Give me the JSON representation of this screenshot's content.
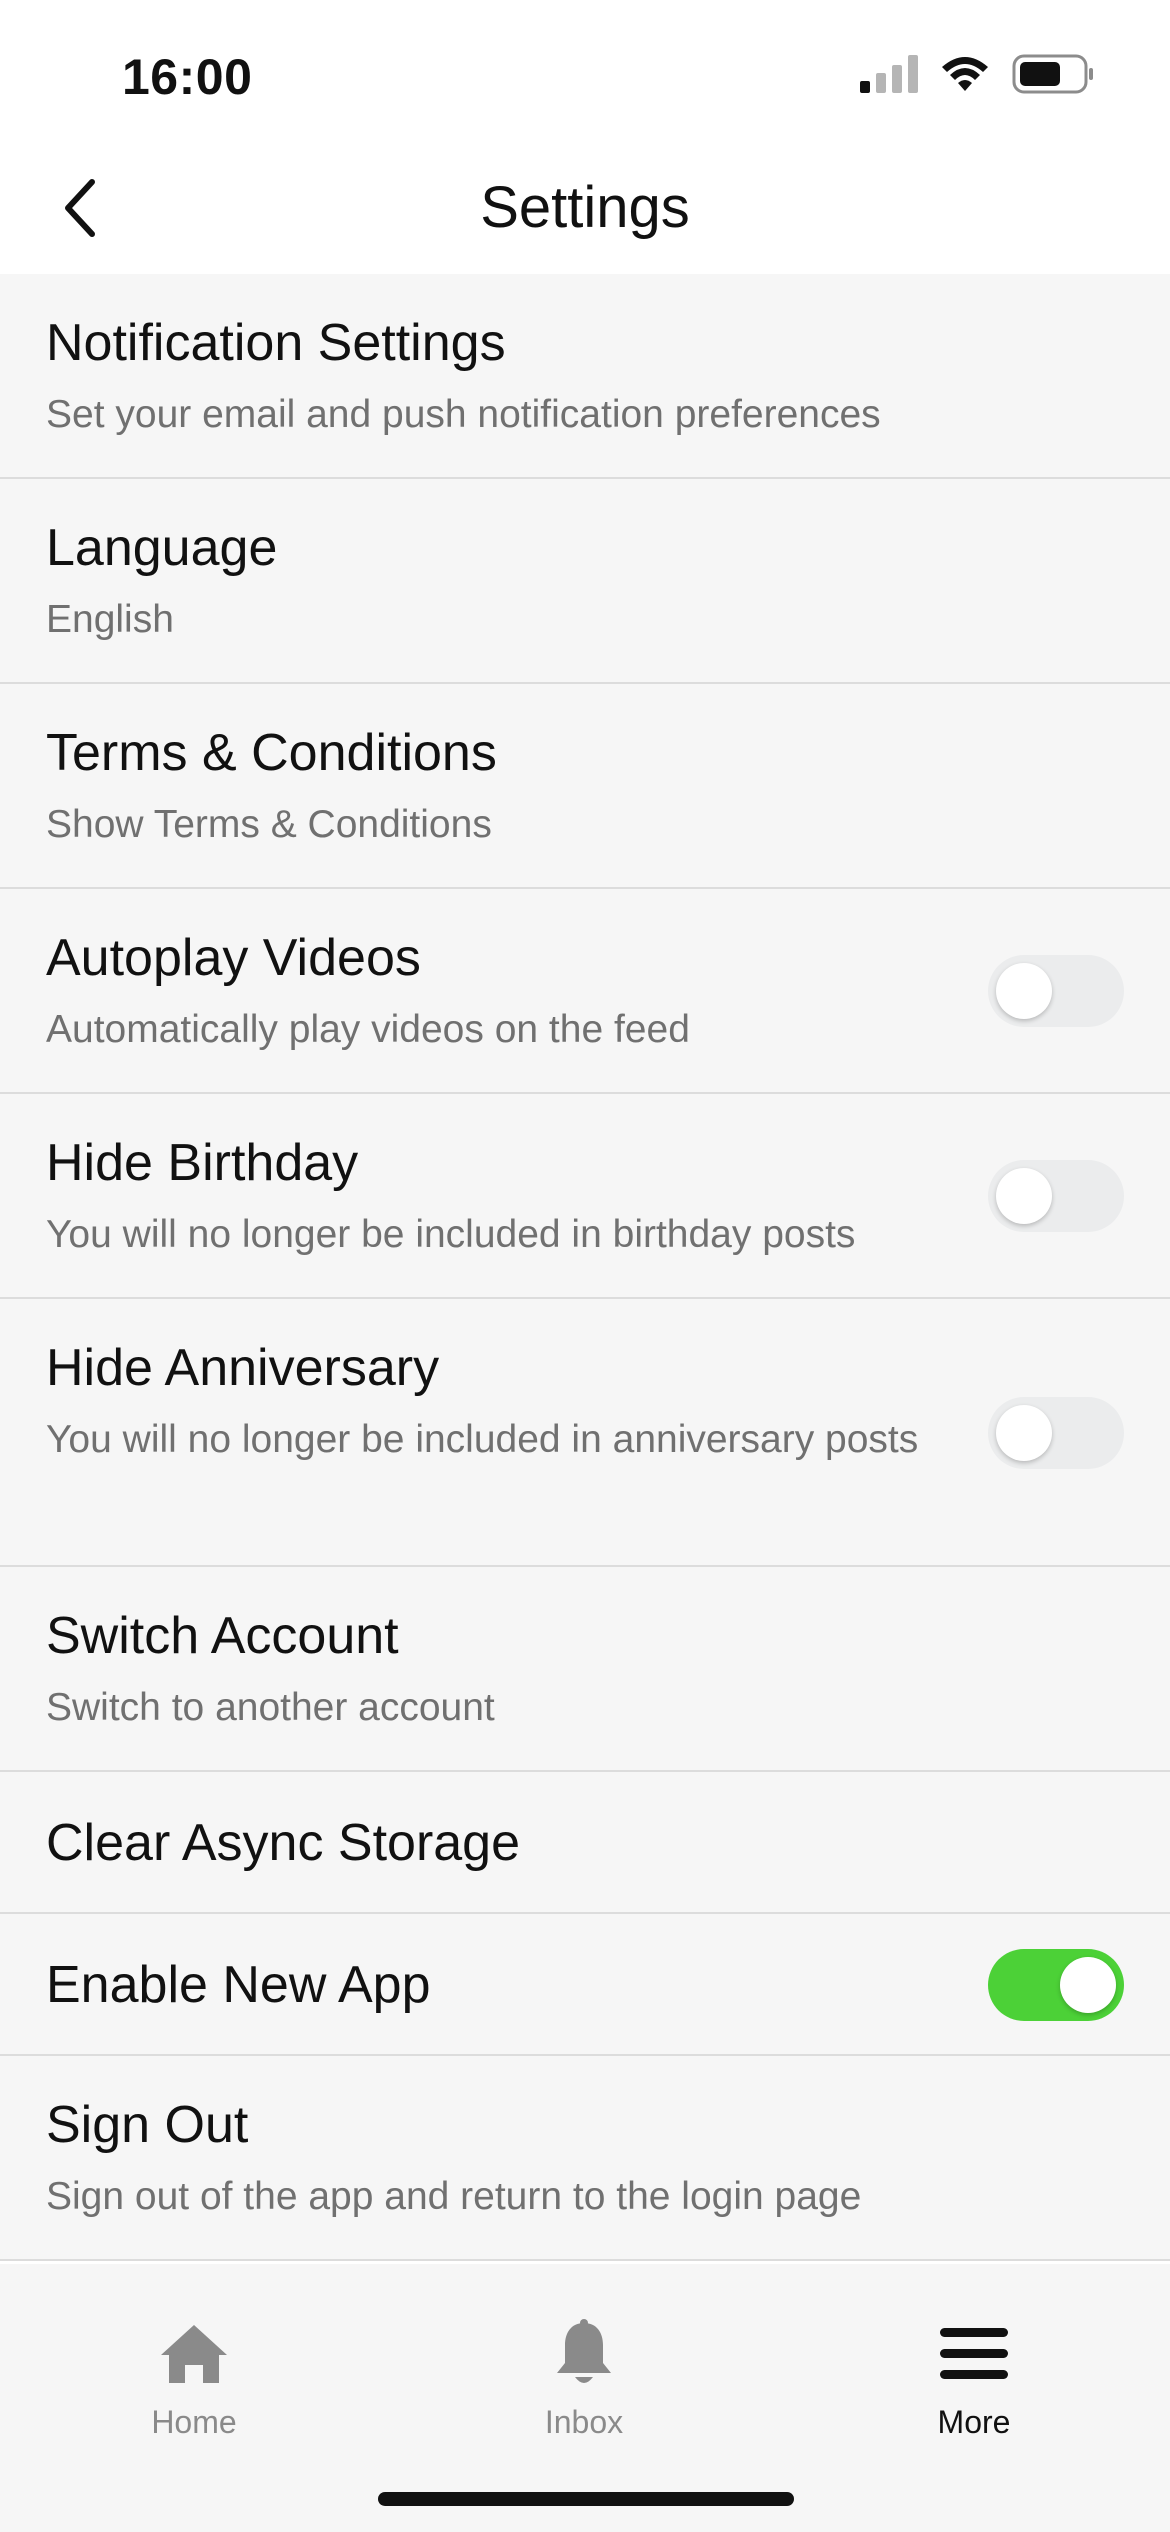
{
  "status_bar": {
    "time": "16:00"
  },
  "nav": {
    "title": "Settings"
  },
  "settings": [
    {
      "title": "Notification Settings",
      "subtitle": "Set your email and push notification preferences"
    },
    {
      "title": "Language",
      "subtitle": "English"
    },
    {
      "title": "Terms & Conditions",
      "subtitle": "Show Terms & Conditions"
    },
    {
      "title": "Autoplay Videos",
      "subtitle": "Automatically play videos on the feed",
      "toggle": "off"
    },
    {
      "title": "Hide Birthday",
      "subtitle": "You will no longer be included in birthday posts",
      "toggle": "off"
    },
    {
      "title": "Hide Anniversary",
      "subtitle": "You will no longer be included in anniversary posts",
      "toggle": "off"
    },
    {
      "title": "Switch Account",
      "subtitle": "Switch to another account"
    },
    {
      "title": "Clear Async Storage"
    },
    {
      "title": "Enable New App",
      "toggle": "on"
    },
    {
      "title": "Sign Out",
      "subtitle": "Sign out of the app and return to the login page"
    }
  ],
  "tabs": [
    {
      "label": "Home",
      "icon": "home-icon"
    },
    {
      "label": "Inbox",
      "icon": "bell-icon"
    },
    {
      "label": "More",
      "icon": "hamburger-menu-icon",
      "active": true
    }
  ],
  "colors": {
    "toggle_on": "#4cd137",
    "toggle_off": "#ebeced",
    "list_background": "#f6f6f6"
  }
}
